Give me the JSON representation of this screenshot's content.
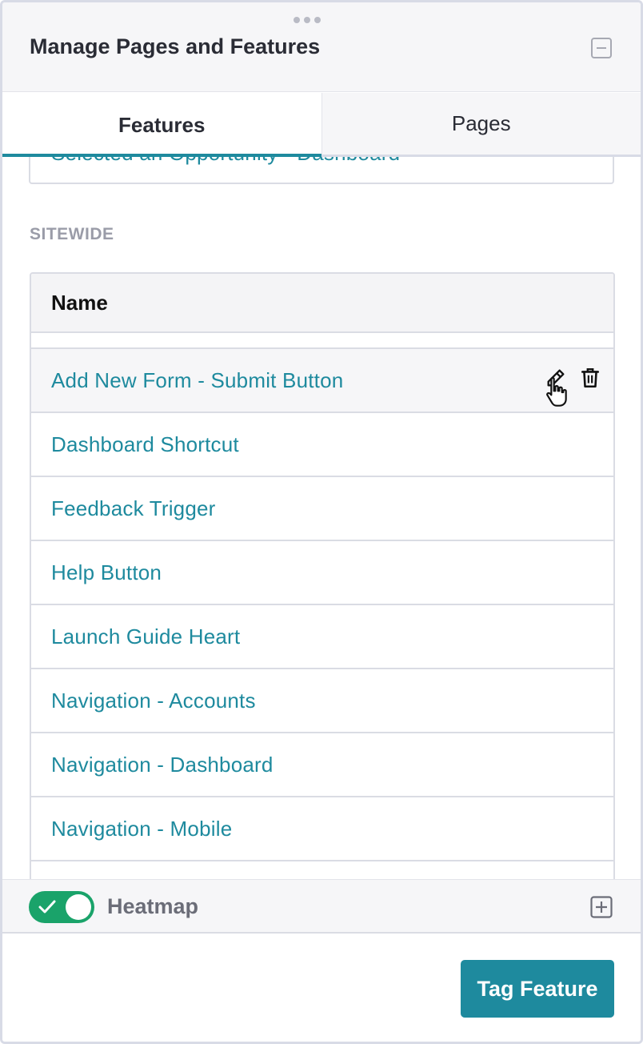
{
  "header": {
    "title": "Manage Pages and Features",
    "minimize_icon": "minus-square-icon"
  },
  "tabs": [
    {
      "label": "Features",
      "active": true
    },
    {
      "label": "Pages",
      "active": false
    }
  ],
  "previous_section_item": "Selected an Opportunity - Dashboard",
  "section": {
    "label": "SITEWIDE",
    "column_header": "Name",
    "rows": [
      "Add New Form - Submit Button",
      "Dashboard Shortcut",
      "Feedback Trigger",
      "Help Button",
      "Launch Guide Heart",
      "Navigation - Accounts",
      "Navigation - Dashboard",
      "Navigation - Mobile"
    ],
    "hovered_row_actions": [
      "pencil-icon",
      "trash-icon"
    ]
  },
  "heatmap": {
    "label": "Heatmap",
    "enabled": true
  },
  "footer": {
    "primary_button": "Tag Feature"
  },
  "colors": {
    "accent": "#1e8a9e",
    "toggle_on": "#1aa36a"
  }
}
